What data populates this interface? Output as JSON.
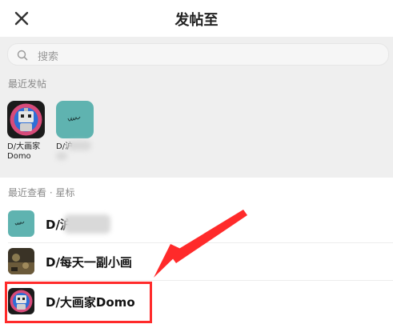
{
  "header": {
    "title": "发帖至",
    "close_icon": "close-icon"
  },
  "search": {
    "placeholder": "搜索",
    "icon": "search-icon"
  },
  "recent_posts": {
    "label": "最近发帖",
    "items": [
      {
        "name": "D/大画家Domo",
        "icon": "robot-avatar"
      },
      {
        "name": "D/沪",
        "icon": "ux-logo-avatar"
      }
    ]
  },
  "recent_viewed": {
    "label": "最近查看 · 星标",
    "items": [
      {
        "name": "D/沪"
      },
      {
        "name": "D/每天一副小画"
      },
      {
        "name": "D/大画家Domo"
      }
    ]
  },
  "colors": {
    "accent_red": "#ff2a2a",
    "teal_avatar": "#5fb3b0"
  }
}
